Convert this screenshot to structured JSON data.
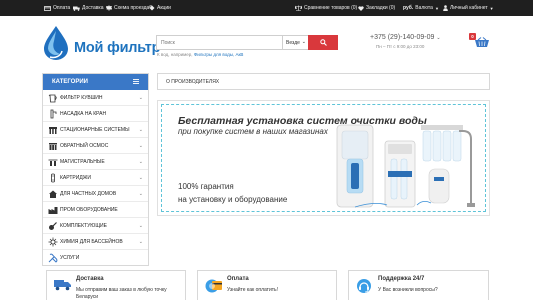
{
  "topbar": {
    "items": [
      {
        "label": "Оплата",
        "icon": "card-icon"
      },
      {
        "label": "Доставка",
        "icon": "truck-icon"
      },
      {
        "label": "Схема проезда",
        "icon": "map-icon"
      },
      {
        "label": "Акции",
        "icon": "tag-icon"
      }
    ],
    "compare": "Сравнение товаров (0)",
    "bookmarks": "Закладки (0)",
    "currency_value": "руб.",
    "currency_label": "Валюта",
    "account": "Личный кабинет"
  },
  "header": {
    "logo_text": "Мой фильтр",
    "search_placeholder": "Поиск",
    "search_scope": "Везде",
    "hint_prefix": "К вод, например,",
    "hint_link": "Фильтры для воды, АкВ",
    "phone": "+375 (29)-140-09-09",
    "hours": "Пн – Пт с 9:00 до 23:00",
    "cart_count": "0"
  },
  "colors": {
    "accent": "#3a78c7",
    "brand": "#1e73be",
    "search_button": "#d9383c",
    "topbar": "#1f1f1f"
  },
  "sidebar": {
    "title": "КАТЕГОРИИ",
    "items": [
      {
        "label": "ФИЛЬТР КУВШИН",
        "icon": "pitcher-icon"
      },
      {
        "label": "НАСАДКА НА КРАН",
        "icon": "faucet-icon"
      },
      {
        "label": "СТАЦИОНАРНЫЕ СИСТЕМЫ",
        "icon": "system-icon"
      },
      {
        "label": "ОБРАТНЫЙ ОСМОС",
        "icon": "osmosis-icon"
      },
      {
        "label": "МАГИСТРАЛЬНЫЕ",
        "icon": "mainline-icon"
      },
      {
        "label": "КАРТРИДЖИ",
        "icon": "cartridge-icon"
      },
      {
        "label": "ДЛЯ ЧАСТНЫХ ДОМОВ",
        "icon": "house-icon"
      },
      {
        "label": "ПРОМ ОБОРУДОВАНИЕ",
        "icon": "factory-icon"
      },
      {
        "label": "КОМПЛЕКТУЮЩИЕ",
        "icon": "parts-icon"
      },
      {
        "label": "ХИМИЯ ДЛЯ БАССЕЙНОВ",
        "icon": "chemistry-icon"
      },
      {
        "label": "УСЛУГИ",
        "icon": "services-icon"
      }
    ]
  },
  "breadcrumb": "О ПРОИЗВОДИТЕЛЯХ",
  "banner": {
    "title": "Бесплатная установка систем очистки воды",
    "subtitle": "при покупке систем в наших магазинах",
    "guarantee_line1": "100% гарантия",
    "guarantee_line2": "на установку и оборудование"
  },
  "features": [
    {
      "title": "Доставка",
      "line1": "Мы отправим ваш заказ в любую точку",
      "line2": "Беларуси",
      "icon": "delivery-truck-icon"
    },
    {
      "title": "Оплата",
      "line1": "Узнайте как оплатить!",
      "line2": "",
      "icon": "payment-icon"
    },
    {
      "title": "Поддержка 24/7",
      "line1": "У Вас возникли вопросы?",
      "line2": "",
      "icon": "support-icon"
    }
  ]
}
